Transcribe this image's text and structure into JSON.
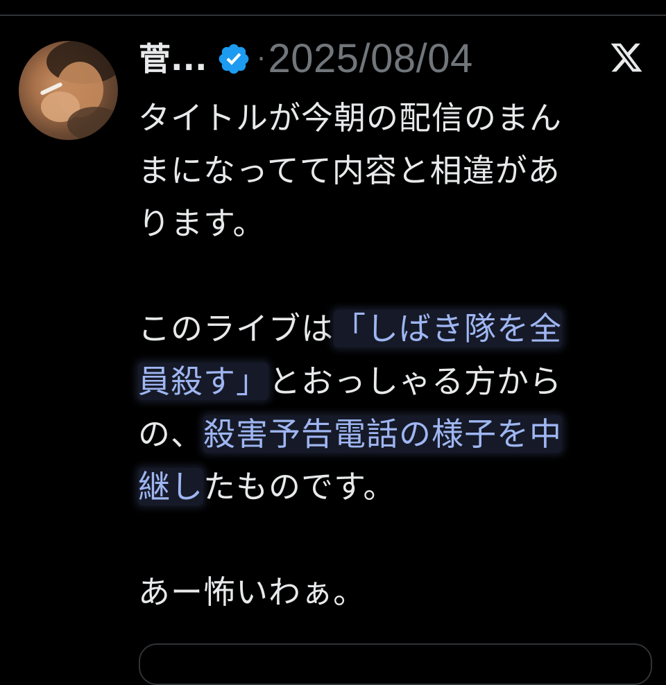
{
  "tweet": {
    "author_name": "菅...",
    "separator": "·",
    "date": "2025/08/04",
    "platform_icon": "x-logo-icon",
    "verified_icon": "verified-badge-icon",
    "text": {
      "line1": "タイトルが今朝の配信のまん",
      "line2": "まになってて内容と相違があ",
      "line3": "ります。",
      "line4_prefix": "このライブは",
      "line4_highlight": "「しばき隊を全",
      "line5_highlight": "員殺す」",
      "line5_suffix": "とおっしゃる方から",
      "line6_prefix": "の、",
      "line6_highlight": "殺害予告電話の様子を中",
      "line7_highlight": "継し",
      "line7_suffix": "たものです。",
      "line8": "あー怖いわぁ。"
    }
  },
  "colors": {
    "background": "#000000",
    "text": "#e7e9ea",
    "muted": "#71767b",
    "verified": "#1d9bf0",
    "highlight_text": "#9fb6f2"
  }
}
